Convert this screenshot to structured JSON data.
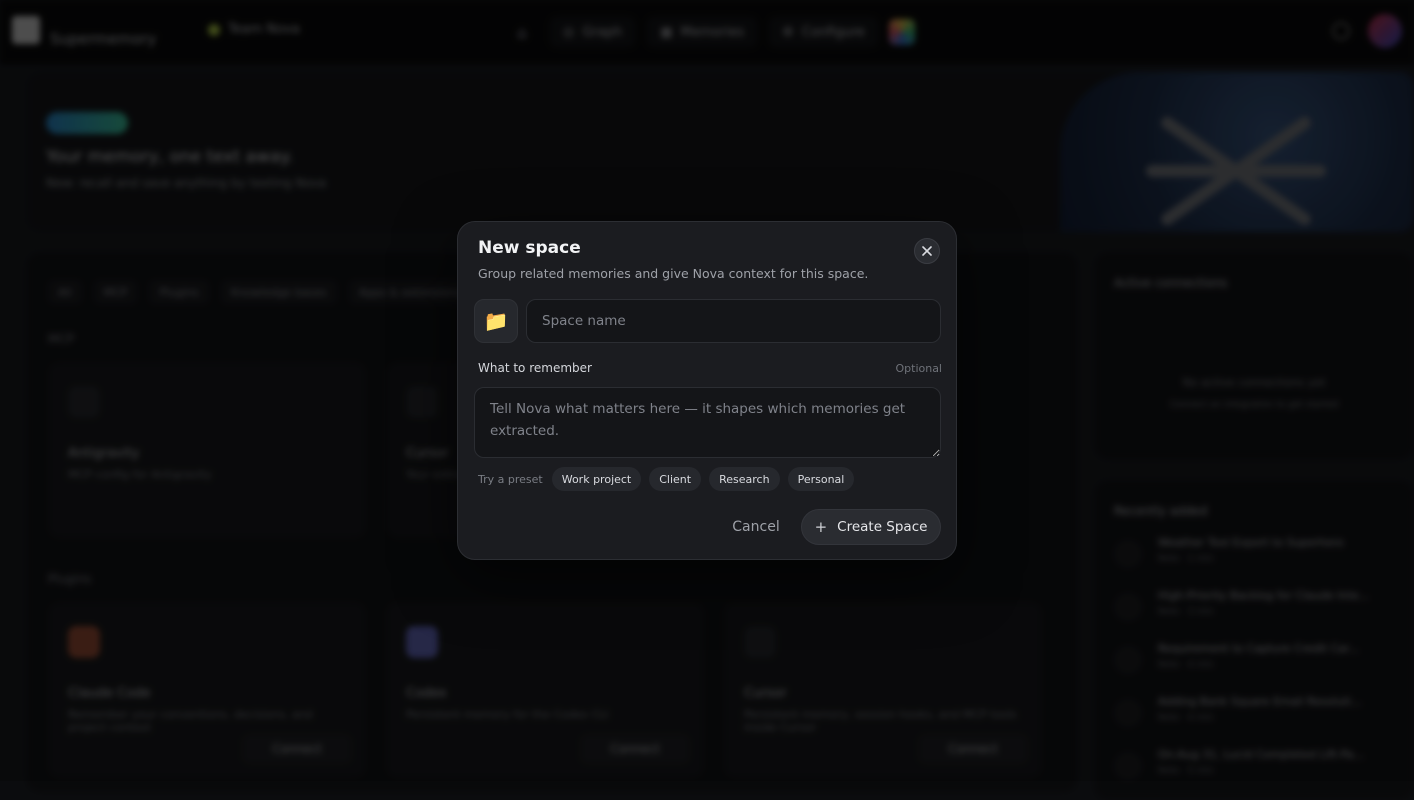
{
  "background": {
    "brand": "Supermemory",
    "team": "Team Nova",
    "nav": [
      {
        "label": "Graph"
      },
      {
        "label": "Memories"
      },
      {
        "label": "Configure"
      }
    ],
    "hero": {
      "title": "Your memory, one text away.",
      "subtitle": "New: recall and save anything by texting Nova"
    },
    "filters": [
      "All",
      "MCP",
      "Plugins",
      "Knowledge bases",
      "Apps & extensions"
    ],
    "sections": {
      "mcp": "MCP",
      "plugins": "Plugins"
    },
    "mcp_cards": [
      {
        "name": "Antigravity",
        "desc": "MCP config for Antigravity"
      },
      {
        "name": "Cursor",
        "desc": "Your editor"
      }
    ],
    "plugin_cards": [
      {
        "name": "Claude Code",
        "desc": "Remember your conventions, decisions, and project context",
        "button": "Connect"
      },
      {
        "name": "Codex",
        "desc": "Persistent memory for the Codex CLI",
        "button": "Connect"
      },
      {
        "name": "Cursor",
        "desc": "Persistent memory, session hooks, and MCP tools inside Cursor",
        "button": "Connect"
      }
    ],
    "side": {
      "connections_title": "Active connections",
      "connections_empty": "No active connections yet",
      "connections_hint": "Connect an integration to get started",
      "recent_title": "Recently added",
      "recent_items": [
        {
          "title": "Weather Tool Export to Superhero",
          "meta": "Note · 1 min"
        },
        {
          "title": "High-Priority Backlog for Claude Inte...",
          "meta": "Note · 3 min"
        },
        {
          "title": "Requirement to Capture Credit Car...",
          "meta": "Note · 4 min"
        },
        {
          "title": "Adding Bank Square Email Resoluti...",
          "meta": "Note · 4 min"
        },
        {
          "title": "On-Aug 31, Lucid Completed Lift-Pa...",
          "meta": "Note · 5 min"
        }
      ]
    }
  },
  "modal": {
    "title": "New space",
    "subtitle": "Group related memories and give Nova context for this space.",
    "close_icon": "close-icon",
    "emoji": "📁",
    "name_placeholder": "Space name",
    "remember_label": "What to remember",
    "optional": "Optional",
    "remember_placeholder": "Tell Nova what matters here — it shapes which memories get extracted.",
    "try_preset": "Try a preset",
    "presets": [
      "Work project",
      "Client",
      "Research",
      "Personal"
    ],
    "cancel": "Cancel",
    "create": "Create Space",
    "create_icon": "+"
  }
}
